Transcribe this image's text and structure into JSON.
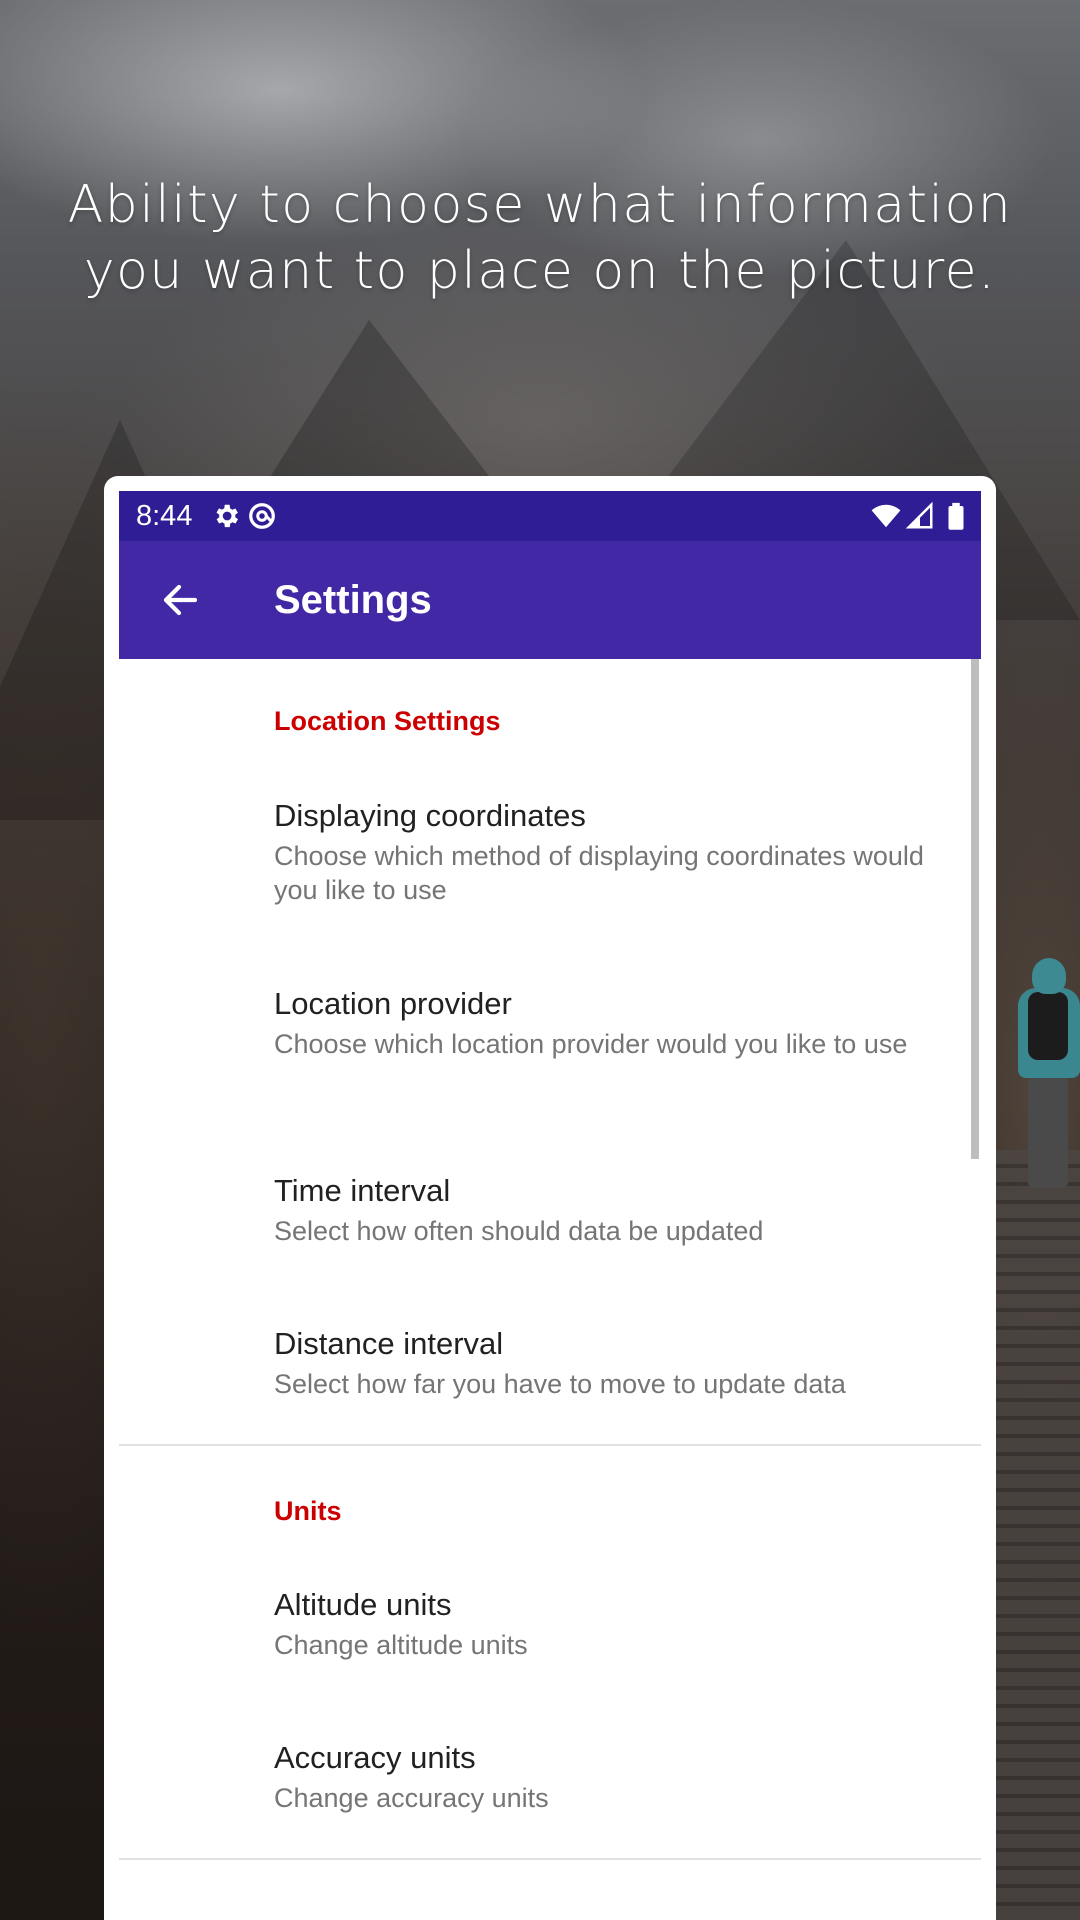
{
  "promo": {
    "headline_line1": "Ability to choose what information",
    "headline_line2": "you want to place on the picture."
  },
  "status_bar": {
    "time": "8:44",
    "icons": [
      "gear-icon",
      "at-sign-icon",
      "wifi-icon",
      "cell-signal-icon",
      "battery-icon"
    ],
    "background": "#2f1d95"
  },
  "app_bar": {
    "title": "Settings",
    "back_icon": "arrow-back-icon",
    "background": "#4328a5"
  },
  "sections": [
    {
      "header": "Location Settings",
      "items": [
        {
          "title": "Displaying coordinates",
          "subtitle": "Choose which method of displaying coordinates would you like to use"
        },
        {
          "title": "Location provider",
          "subtitle": "Choose which location provider would you like to use"
        },
        {
          "title": "Time interval",
          "subtitle": "Select how often should data be updated"
        },
        {
          "title": "Distance interval",
          "subtitle": "Select how far you have to move to update data"
        }
      ]
    },
    {
      "header": "Units",
      "items": [
        {
          "title": "Altitude units",
          "subtitle": "Change altitude units"
        },
        {
          "title": "Accuracy units",
          "subtitle": "Change accuracy units"
        }
      ]
    }
  ],
  "colors": {
    "section_header": "#cc0000",
    "item_title": "#212121",
    "item_subtitle": "#757575"
  }
}
